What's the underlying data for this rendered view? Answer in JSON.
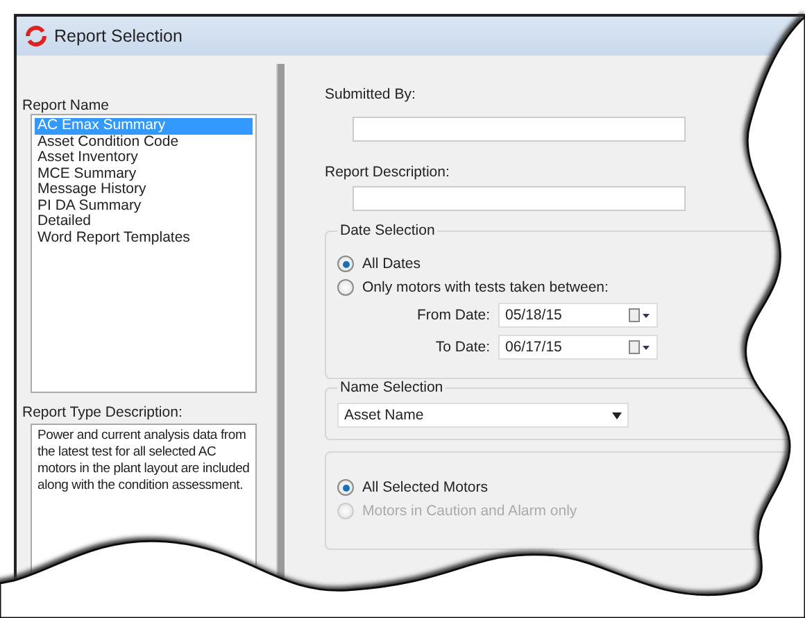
{
  "window": {
    "title": "Report Selection"
  },
  "report_name": {
    "label": "Report Name",
    "items": [
      {
        "label": "AC Emax Summary",
        "selected": true
      },
      {
        "label": "Asset Condition Code",
        "selected": false
      },
      {
        "label": "Asset Inventory",
        "selected": false
      },
      {
        "label": "MCE Summary",
        "selected": false
      },
      {
        "label": "Message History",
        "selected": false
      },
      {
        "label": "PI DA Summary",
        "selected": false
      },
      {
        "label": "Detailed",
        "selected": false
      },
      {
        "label": "Word Report Templates",
        "selected": false
      }
    ]
  },
  "report_type_description": {
    "label": "Report Type Description:",
    "text": "Power and current analysis data from the latest test for all selected AC motors in the plant layout are included along with the condition assessment."
  },
  "submitted_by": {
    "label": "Submitted By:"
  },
  "report_description": {
    "label": "Report Description:"
  },
  "date_selection": {
    "title": "Date Selection",
    "options": [
      {
        "label": "All Dates",
        "selected": true
      },
      {
        "label": "Only motors with tests taken between:",
        "selected": false
      }
    ],
    "dates": [
      {
        "label": "From Date:",
        "value": "05/18/15"
      },
      {
        "label": "To Date:",
        "value": "06/17/15"
      }
    ]
  },
  "name_selection": {
    "title": "Name Selection",
    "value": "Asset Name"
  },
  "motor_filter": {
    "options": [
      {
        "label": "All Selected Motors",
        "selected": true,
        "disabled": false
      },
      {
        "label": "Motors in Caution and Alarm only",
        "selected": false,
        "disabled": true
      }
    ]
  }
}
